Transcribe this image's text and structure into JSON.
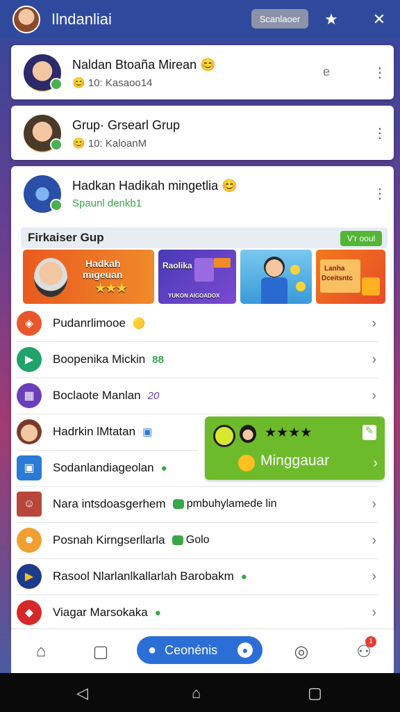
{
  "header": {
    "title": "Ilndanliai",
    "pill_label": "Scanlaoer"
  },
  "chats": [
    {
      "name": "Naldan Btoaña Mirean",
      "emoji": "😊",
      "sub": "10: Kasaoo14",
      "sub_emoji": "😊"
    },
    {
      "name": "Grup· Grsearl Grup",
      "sub": "10: KaloanM",
      "sub_emoji": "😊"
    },
    {
      "name": "Hadkan Hadikah mingetlia",
      "emoji": "😊",
      "sub": "Spaunl denkb1"
    }
  ],
  "featured": {
    "title": "Firkaiser Gup",
    "action": "V'r ooul",
    "banners": [
      {
        "line1": "Hadkah",
        "line2": "migeuan",
        "stars": "★★★"
      },
      {
        "line1": "Raolika",
        "line2": "YUKON AIGOADOX"
      },
      {},
      {
        "line1": "Lanha",
        "line2": "Dceitsntc"
      }
    ]
  },
  "list": [
    {
      "label": "Pudanrlimooe",
      "badge": "🟡",
      "color": "#e8572b"
    },
    {
      "label": "Boopenika Mickin",
      "badge": "88",
      "color": "#1fa36b"
    },
    {
      "label": "Boclaote Manlan",
      "badge": "20",
      "color": "#6a3fb8"
    },
    {
      "label": "Hadrkin lMtatan",
      "badge": "▣",
      "color": "#c0603b"
    },
    {
      "label": "Sodanlandiageolan",
      "badge": "●",
      "color": "#2a7ad6"
    },
    {
      "label": "Nara intsdoasgerhem",
      "badge2": "pmbuhylamede lin",
      "color": "#b8463a"
    },
    {
      "label": "Posnah Kirngserllarla",
      "badge2": "Golo",
      "color": "#f0a030"
    },
    {
      "label": "Rasool Nlarlanlkallarlah Barobakm",
      "color": "#1e3a8a"
    },
    {
      "label": "Viagar Marsokaka",
      "color": "#d62828"
    }
  ],
  "promo": {
    "label": "Minggauar",
    "stars": "★★★★"
  },
  "nav": {
    "center_label": "Ceonénis",
    "badge_count": "1"
  }
}
